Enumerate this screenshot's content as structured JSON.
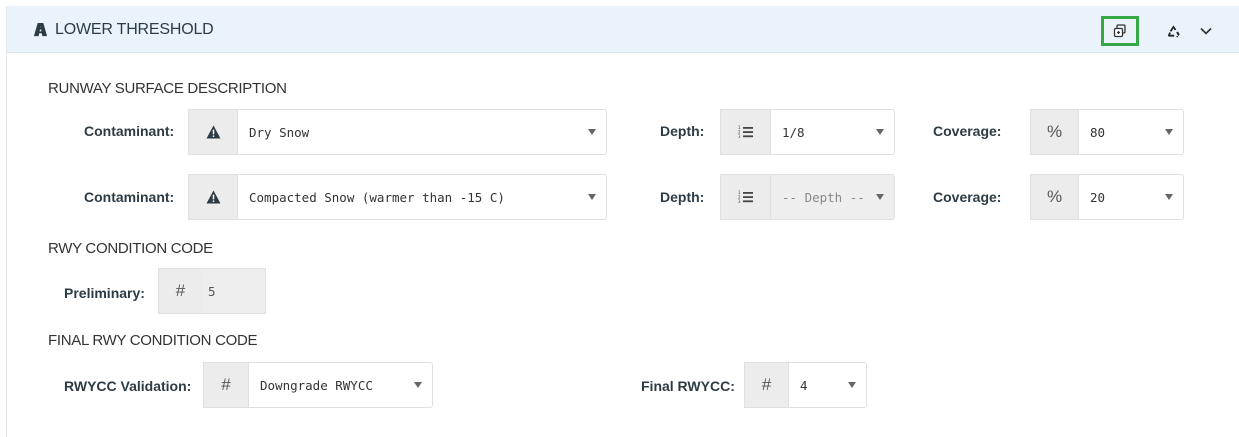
{
  "header": {
    "title": "LOWER THRESHOLD",
    "icons": {
      "title_icon": "runway-icon",
      "copy": "copy-icon",
      "reset": "recycle-icon",
      "collapse": "chevron-down-icon"
    },
    "copy_highlight_color": "#33a845",
    "background": "#e9f3f9"
  },
  "surface": {
    "section_title": "RUNWAY SURFACE DESCRIPTION",
    "rows": [
      {
        "contaminant_label": "Contaminant:",
        "contaminant_value": "Dry Snow",
        "depth_label": "Depth:",
        "depth_value": "1/8",
        "coverage_label": "Coverage:",
        "coverage_addon": "%",
        "coverage_value": "80"
      },
      {
        "contaminant_label": "Contaminant:",
        "contaminant_value": "Compacted Snow (warmer than -15 C)",
        "depth_label": "Depth:",
        "depth_value": "-- Depth --",
        "coverage_label": "Coverage:",
        "coverage_addon": "%",
        "coverage_value": "20"
      }
    ]
  },
  "rwycc": {
    "section_title": "RWY CONDITION CODE",
    "preliminary_label": "Preliminary:",
    "preliminary_addon": "#",
    "preliminary_value": "5"
  },
  "final": {
    "section_title": "FINAL RWY CONDITION CODE",
    "validation_label": "RWYCC Validation:",
    "validation_addon": "#",
    "validation_value": "Downgrade RWYCC",
    "final_label": "Final RWYCC:",
    "final_addon": "#",
    "final_value": "4"
  }
}
